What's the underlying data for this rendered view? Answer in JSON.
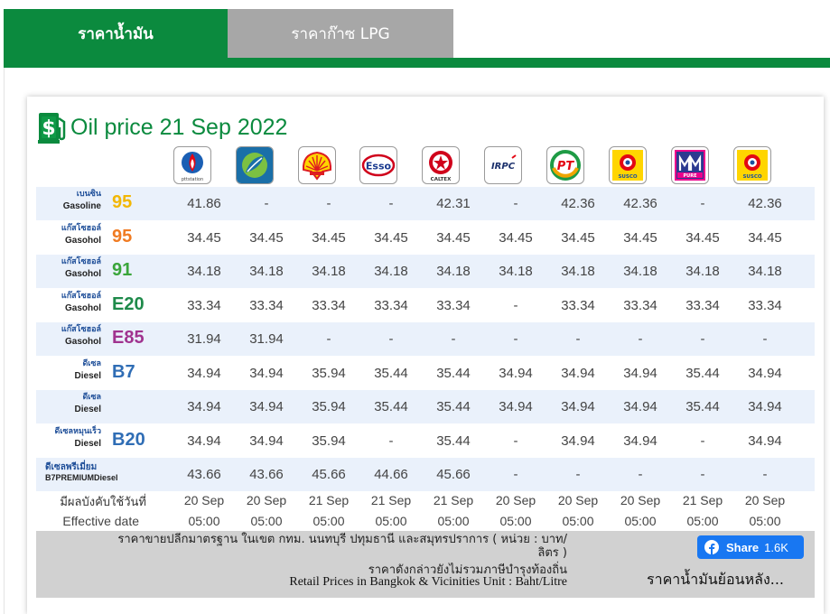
{
  "tabs": [
    {
      "label": "ราคาน้ำมัน",
      "active": true
    },
    {
      "label": "ราคาก๊าซ LPG",
      "active": false
    }
  ],
  "title": "Oil price 21 Sep 2022",
  "colors": {
    "brand_green": "#0b8a3e",
    "row_alt": "#eaf1fb",
    "facebook_blue": "#1877f2"
  },
  "brands": [
    {
      "name": "PTT Station",
      "icon": "ptt-logo"
    },
    {
      "name": "Bangchak",
      "icon": "bangchak-logo"
    },
    {
      "name": "Shell",
      "icon": "shell-logo"
    },
    {
      "name": "Esso",
      "icon": "esso-logo"
    },
    {
      "name": "Caltex",
      "icon": "caltex-logo"
    },
    {
      "name": "IRPC",
      "icon": "irpc-logo"
    },
    {
      "name": "PT",
      "icon": "pt-logo"
    },
    {
      "name": "Susco",
      "icon": "susco-logo"
    },
    {
      "name": "Pure",
      "icon": "pure-logo"
    },
    {
      "name": "Susco",
      "icon": "susco-logo"
    }
  ],
  "fuels": [
    {
      "th": "เบนซิน",
      "en": "Gasoline",
      "code": "95",
      "code_color": "#f2b705",
      "prices": [
        "41.86",
        "-",
        "-",
        "-",
        "42.31",
        "-",
        "42.36",
        "42.36",
        "-",
        "42.36"
      ]
    },
    {
      "th": "แก๊สโซฮอล์",
      "en": "Gasohol",
      "code": "95",
      "code_color": "#f07b22",
      "prices": [
        "34.45",
        "34.45",
        "34.45",
        "34.45",
        "34.45",
        "34.45",
        "34.45",
        "34.45",
        "34.45",
        "34.45"
      ]
    },
    {
      "th": "แก๊สโซฮอล์",
      "en": "Gasohol",
      "code": "91",
      "code_color": "#3aa53a",
      "prices": [
        "34.18",
        "34.18",
        "34.18",
        "34.18",
        "34.18",
        "34.18",
        "34.18",
        "34.18",
        "34.18",
        "34.18"
      ]
    },
    {
      "th": "แก๊สโซฮอล์",
      "en": "Gasohol",
      "code": "E20",
      "code_color": "#1e8a4a",
      "prices": [
        "33.34",
        "33.34",
        "33.34",
        "33.34",
        "33.34",
        "-",
        "33.34",
        "33.34",
        "33.34",
        "33.34"
      ]
    },
    {
      "th": "แก๊สโซฮอล์",
      "en": "Gasohol",
      "code": "E85",
      "code_color": "#a0338f",
      "prices": [
        "31.94",
        "31.94",
        "-",
        "-",
        "-",
        "-",
        "-",
        "-",
        "-",
        "-"
      ]
    },
    {
      "th": "ดีเซล",
      "en": "Diesel",
      "code": "B7",
      "code_color": "#2f6db5",
      "prices": [
        "34.94",
        "34.94",
        "35.94",
        "35.44",
        "35.44",
        "34.94",
        "34.94",
        "34.94",
        "35.44",
        "34.94"
      ]
    },
    {
      "th": "ดีเซล",
      "en": "Diesel",
      "code": "",
      "code_color": "#2f6db5",
      "prices": [
        "34.94",
        "34.94",
        "35.94",
        "35.44",
        "35.44",
        "34.94",
        "34.94",
        "34.94",
        "35.44",
        "34.94"
      ]
    },
    {
      "th": "ดีเซลหมุนเร็ว",
      "en": "Diesel",
      "code": "B20",
      "code_color": "#2f6db5",
      "prices": [
        "34.94",
        "34.94",
        "35.94",
        "-",
        "35.44",
        "-",
        "34.94",
        "34.94",
        "-",
        "34.94"
      ]
    },
    {
      "th": "ดีเซลพรีเมี่ยม",
      "en": "B7PREMIUMDiesel",
      "code": "",
      "code_color": "#2f6db5",
      "premium": true,
      "prices": [
        "43.66",
        "43.66",
        "45.66",
        "44.66",
        "45.66",
        "-",
        "-",
        "-",
        "-",
        "-"
      ]
    }
  ],
  "effective": {
    "label_th": "มีผลบังคับใช้วันที่",
    "label_en": "Effective date",
    "dates": [
      "20 Sep",
      "20 Sep",
      "21 Sep",
      "21 Sep",
      "21 Sep",
      "20 Sep",
      "20 Sep",
      "20 Sep",
      "21 Sep",
      "20 Sep"
    ],
    "times": [
      "05:00",
      "05:00",
      "05:00",
      "05:00",
      "05:00",
      "05:00",
      "05:00",
      "05:00",
      "05:00",
      "05:00"
    ]
  },
  "footer": {
    "note_line1": "ราคาขายปลีกมาตรฐาน ในเขต กทม. นนทบุรี ปทุมธานี และสมุทรปราการ ( หน่วย : บาท/",
    "note_line2": "ลิตร )",
    "note_line3": "ราคาดังกล่าวยังไม่รวมภาษีบำรุงท้องถิ่น",
    "note_en": "Retail Prices in Bangkok & Vicinities Unit : Baht/Litre",
    "share_label": "Share",
    "share_count": "1.6K",
    "history_link": "ราคาน้ำมันย้อนหลัง..."
  }
}
